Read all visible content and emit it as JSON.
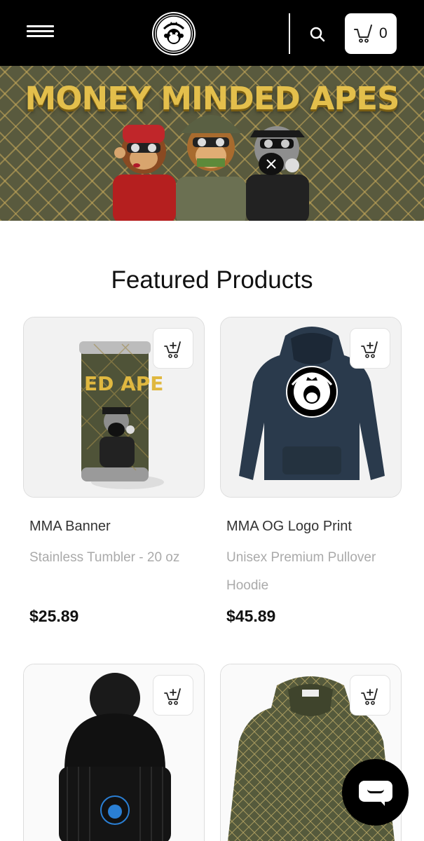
{
  "header": {
    "menu_icon": "hamburger-menu-icon",
    "logo_alt": "MONEY MINDED APES",
    "search_icon": "search-icon",
    "cart_icon": "shopping-cart-icon",
    "cart_count": "0"
  },
  "hero": {
    "title": "MONEY MINDED APES"
  },
  "featured": {
    "title": "Featured Products",
    "add_to_cart_icon": "add-to-cart-icon",
    "products": [
      {
        "name": "MMA Banner",
        "description": "Stainless Tumbler - 20 oz",
        "price": "$25.89"
      },
      {
        "name": "MMA OG Logo Print",
        "description": "Unisex Premium Pullover Hoodie",
        "price": "$45.89"
      },
      {
        "name": "",
        "description": "",
        "price": ""
      },
      {
        "name": "",
        "description": "",
        "price": ""
      }
    ]
  },
  "chat": {
    "icon": "chat-icon"
  },
  "colors": {
    "header_bg": "#000000",
    "hero_gold": "#e3bf4c",
    "hero_bg": "#595a3e",
    "text_secondary": "#aaaaaa"
  }
}
